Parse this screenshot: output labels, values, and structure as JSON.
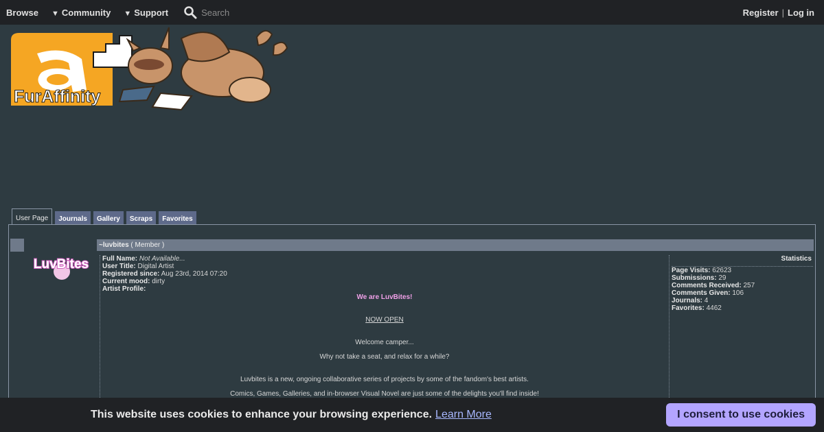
{
  "nav": {
    "browse": "Browse",
    "community": "Community",
    "support": "Support",
    "search_placeholder": "Search",
    "register": "Register",
    "separator": "|",
    "login": "Log in"
  },
  "banner": {
    "logo_text": "FurAffinity"
  },
  "tabs": [
    "User Page",
    "Journals",
    "Gallery",
    "Scraps",
    "Favorites"
  ],
  "profile": {
    "username": "~luvbites",
    "role": "( Member )",
    "avatar_text": "LuvBites",
    "fields": [
      {
        "label": "Full Name:",
        "value": "Not Available..."
      },
      {
        "label": "User Title:",
        "value": "Digital Artist"
      },
      {
        "label": "Registered since:",
        "value": "Aug 23rd, 2014 07:20"
      },
      {
        "label": "Current mood:",
        "value": "dirty"
      },
      {
        "label": "Artist Profile:",
        "value": ""
      }
    ],
    "bio": {
      "title": "We are LuvBites!",
      "now_open": "NOW OPEN",
      "welcome": "Welcome camper...",
      "seat": "Why not take a seat, and relax for a while?",
      "series": "Luvbites is a new, ongoing collaborative series of projects by some of the fandom's best artists.",
      "delights": "Comics, Games, Galleries, and in-browser Visual Novel are just some of the delights you'll find inside!"
    }
  },
  "stats": {
    "heading": "Statistics",
    "items": [
      {
        "label": "Page Visits:",
        "value": "62623"
      },
      {
        "label": "Submissions:",
        "value": "29"
      },
      {
        "label": "Comments Received:",
        "value": "257"
      },
      {
        "label": "Comments Given:",
        "value": "106"
      },
      {
        "label": "Journals:",
        "value": "4"
      },
      {
        "label": "Favorites:",
        "value": "4462"
      }
    ]
  },
  "cookie": {
    "message": "This website uses cookies to enhance your browsing experience.",
    "learn_more": "Learn More",
    "consent": "I consent to use cookies"
  },
  "colors": {
    "background": "#2e3b41",
    "nav_bg": "#202225",
    "tab_bg": "#5e6a8a",
    "accent_pink": "#f0a0e8",
    "consent_button": "#b3a5ff",
    "logo_orange": "#f5a623"
  }
}
